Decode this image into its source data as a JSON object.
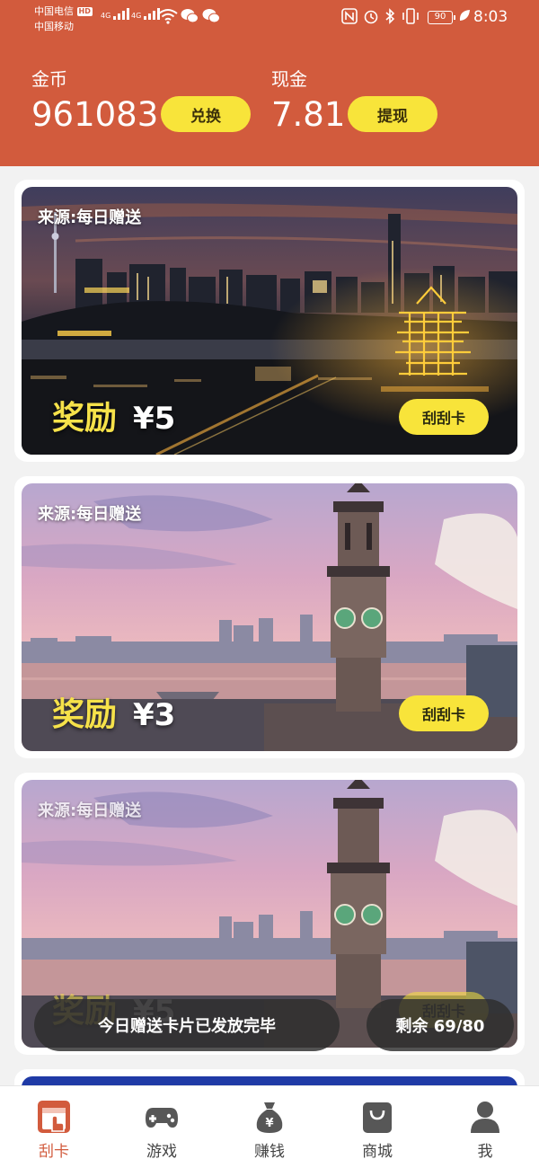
{
  "status_bar": {
    "carrier_1": "中国电信",
    "carrier_1_badge": "HD",
    "carrier_2": "中国移动",
    "net_1": "4G",
    "net_2": "4G",
    "battery": "90",
    "time": "8:03",
    "icons": [
      "wifi-icon",
      "wechat-icon",
      "wechat-icon",
      "nfc-icon",
      "alarm-icon",
      "bluetooth-icon",
      "vibrate-icon",
      "battery-icon",
      "leaf-icon"
    ]
  },
  "wallet": {
    "coins_label": "金币",
    "coins_value": "961083",
    "exchange_label": "兑换",
    "cash_label": "现金",
    "cash_value": "7.81",
    "withdraw_label": "提现"
  },
  "cards": [
    {
      "source": "来源:每日赠送",
      "reward_label": "奖励",
      "reward_amount": "¥5",
      "button_label": "刮刮卡",
      "image": "night-city-tower"
    },
    {
      "source": "来源:每日赠送",
      "reward_label": "奖励",
      "reward_amount": "¥3",
      "button_label": "刮刮卡",
      "image": "clock-tower-sunset"
    },
    {
      "source": "来源:每日赠送",
      "reward_label": "奖励",
      "reward_amount": "¥5",
      "button_label": "刮刮卡",
      "image": "clock-tower-sunset"
    }
  ],
  "toasts": {
    "left": "今日赠送卡片已发放完毕",
    "right": "剩余 69/80"
  },
  "tabbar": {
    "items": [
      {
        "label": "刮卡",
        "icon": "scratch-card-icon",
        "active": true
      },
      {
        "label": "游戏",
        "icon": "gamepad-icon",
        "active": false
      },
      {
        "label": "赚钱",
        "icon": "money-bag-icon",
        "active": false
      },
      {
        "label": "商城",
        "icon": "shopping-bag-icon",
        "active": false
      },
      {
        "label": "我",
        "icon": "user-icon",
        "active": false
      }
    ]
  },
  "colors": {
    "header_bg": "#d25b3d",
    "accent_yellow": "#f8e43a",
    "reward_yellow": "#f6e24a",
    "active_tab": "#d25b3d"
  }
}
